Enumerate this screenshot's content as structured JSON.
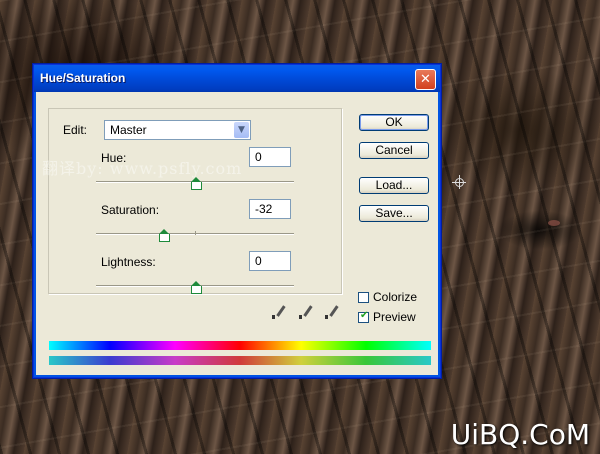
{
  "window": {
    "title": "Hue/Saturation",
    "close_glyph": "✕"
  },
  "edit": {
    "label": "Edit:",
    "selected": "Master"
  },
  "sliders": [
    {
      "label": "Hue:",
      "value": "0",
      "level": 0
    },
    {
      "label": "Saturation:",
      "value": "-32",
      "level": -32
    },
    {
      "label": "Lightness:",
      "value": "0",
      "level": 0
    }
  ],
  "buttons": {
    "ok": "OK",
    "cancel": "Cancel",
    "load": "Load...",
    "save": "Save..."
  },
  "checkboxes": {
    "colorize": {
      "label": "Colorize",
      "checked": false
    },
    "preview": {
      "label": "Preview",
      "checked": true
    }
  },
  "icons": {
    "eyedropper": "eyedropper-icon",
    "eyedropper_plus": "eyedropper-plus-icon",
    "eyedropper_minus": "eyedropper-minus-icon",
    "crosshair": "crosshair-cursor-icon",
    "close": "close-icon"
  },
  "watermark": "翻译by: www.psfly.com",
  "brand": "UiBQ.CoM",
  "colors": {
    "title_bar": "#0054e3",
    "dialog_bg": "#ece9d8",
    "slider_thumb": "#1d8a3a"
  }
}
